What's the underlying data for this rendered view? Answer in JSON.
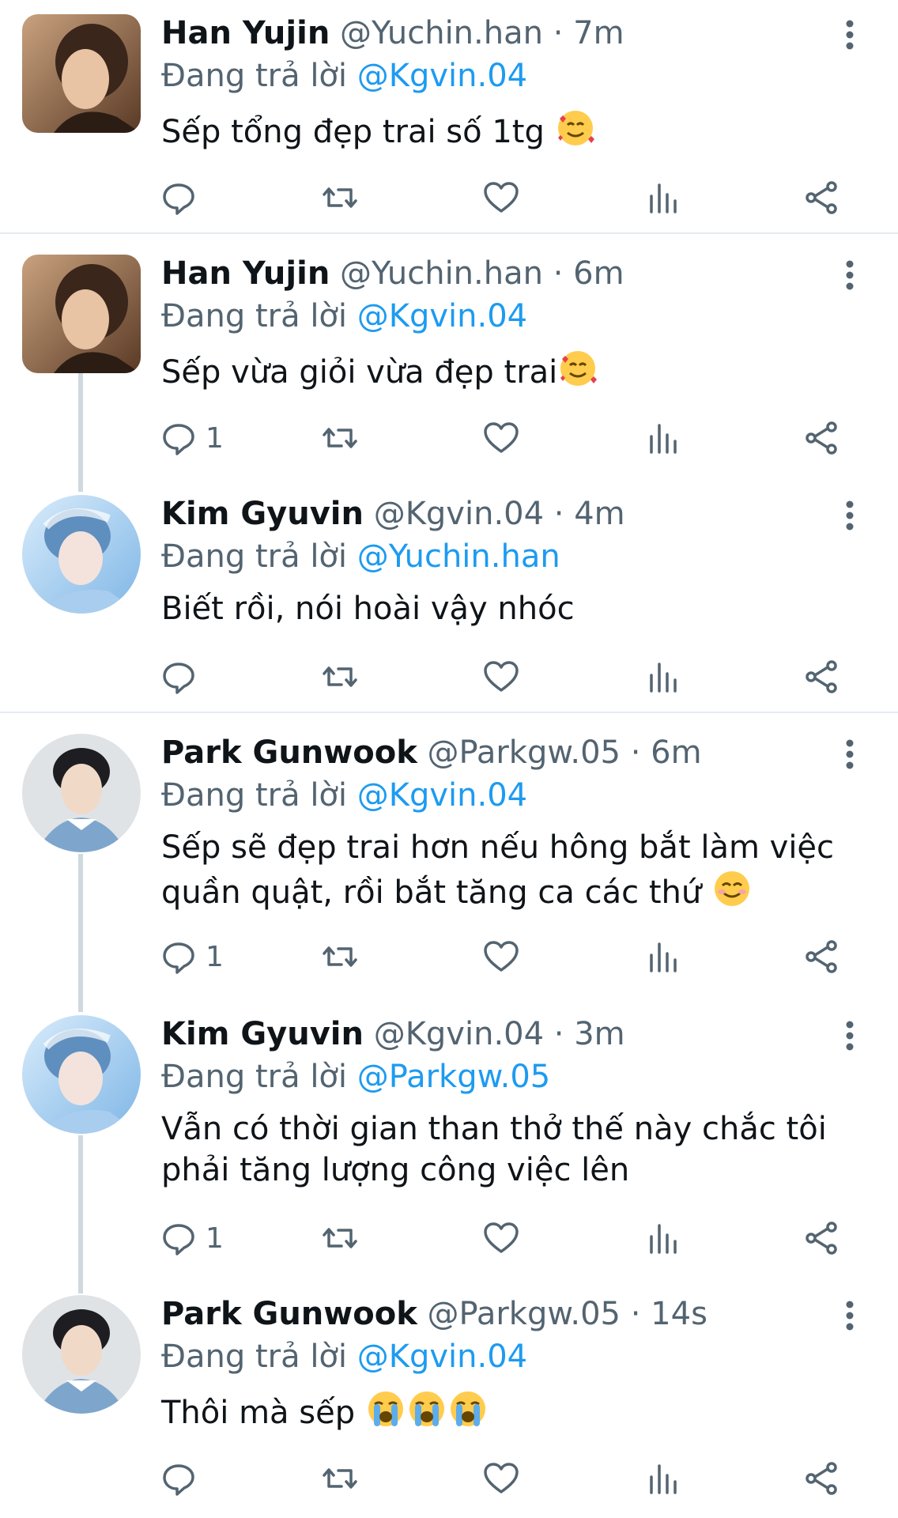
{
  "colors": {
    "accent": "#1d9bf0",
    "text_primary": "#0f1419",
    "text_secondary": "#536471",
    "divider": "#e6ecf0",
    "thread_line": "#cfd9de"
  },
  "reply_prefix": "Đang trả lời",
  "tweets": [
    {
      "name": "Han Yujin",
      "handle": "@Yuchin.han",
      "time": "· 7m",
      "reply_to": "@Kgvin.04",
      "text": "Sếp tổng đẹp trai số 1tg",
      "text_line2": "",
      "emojis": [
        "smiling-face-with-hearts"
      ],
      "reply_count": "",
      "avatar": "han-yujin-avatar"
    },
    {
      "name": "Han Yujin",
      "handle": "@Yuchin.han",
      "time": "· 6m",
      "reply_to": "@Kgvin.04",
      "text": "Sếp vừa giỏi vừa đẹp trai",
      "text_line2": "",
      "emojis": [
        "smiling-face-with-hearts"
      ],
      "reply_count": "1",
      "avatar": "han-yujin-avatar"
    },
    {
      "name": "Kim Gyuvin",
      "handle": "@Kgvin.04",
      "time": "· 4m",
      "reply_to": "@Yuchin.han",
      "text": "Biết rồi, nói hoài vậy nhóc",
      "text_line2": "",
      "emojis": [],
      "reply_count": "",
      "avatar": "kim-gyuvin-avatar"
    },
    {
      "name": "Park Gunwook",
      "handle": "@Parkgw.05",
      "time": "· 6m",
      "reply_to": "@Kgvin.04",
      "text": "Sếp sẽ đẹp trai hơn nếu hông bắt làm việc",
      "text_line2": "quần quật, rồi bắt tăng ca các thứ",
      "emojis": [
        "smiling-face"
      ],
      "reply_count": "1",
      "avatar": "park-gunwook-avatar"
    },
    {
      "name": "Kim Gyuvin",
      "handle": "@Kgvin.04",
      "time": "· 3m",
      "reply_to": "@Parkgw.05",
      "text": "Vẫn có thời gian than thở thế này chắc tôi",
      "text_line2": "phải tăng lượng công việc lên",
      "emojis": [],
      "reply_count": "1",
      "avatar": "kim-gyuvin-avatar"
    },
    {
      "name": "Park Gunwook",
      "handle": "@Parkgw.05",
      "time": "· 14s",
      "reply_to": "@Kgvin.04",
      "text": "Thôi mà sếp",
      "text_line2": "",
      "emojis": [
        "loudly-crying-face",
        "loudly-crying-face",
        "loudly-crying-face"
      ],
      "reply_count": "",
      "avatar": "park-gunwook-avatar"
    }
  ],
  "action_icons": [
    "reply-icon",
    "retweet-icon",
    "like-icon",
    "analytics-icon",
    "share-icon"
  ]
}
